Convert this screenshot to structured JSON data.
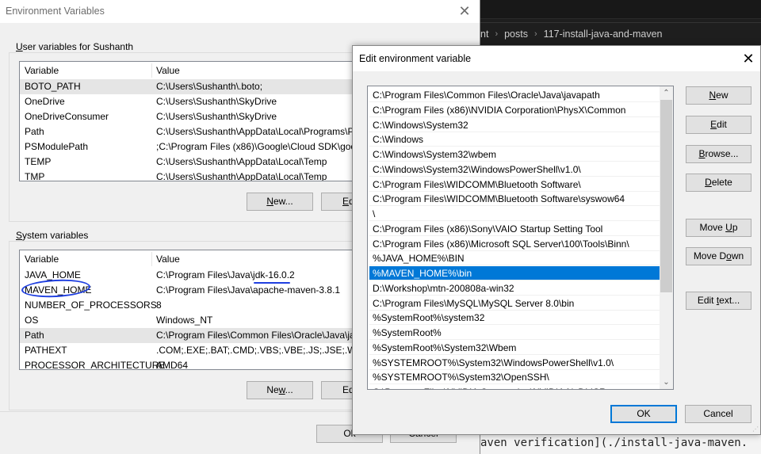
{
  "editor": {
    "breadcrumb": [
      "nt",
      "posts",
      "117-install-java-and-maven"
    ],
    "code_line": "aven verification](./install-java-maven."
  },
  "env_window": {
    "title": "Environment Variables",
    "close_icon": "close-icon",
    "user_group_label": "User variables for Sushanth",
    "user_group_hotkey": "U",
    "user_columns": [
      "Variable",
      "Value"
    ],
    "user_vars": [
      {
        "name": "BOTO_PATH",
        "value": "C:\\Users\\Sushanth\\.boto;"
      },
      {
        "name": "OneDrive",
        "value": "C:\\Users\\Sushanth\\SkyDrive"
      },
      {
        "name": "OneDriveConsumer",
        "value": "C:\\Users\\Sushanth\\SkyDrive"
      },
      {
        "name": "Path",
        "value": "C:\\Users\\Sushanth\\AppData\\Local\\Programs\\P"
      },
      {
        "name": "PSModulePath",
        "value": ";C:\\Program Files (x86)\\Google\\Cloud SDK\\goo"
      },
      {
        "name": "TEMP",
        "value": "C:\\Users\\Sushanth\\AppData\\Local\\Temp"
      },
      {
        "name": "TMP",
        "value": "C:\\Users\\Sushanth\\AppData\\Local\\Temp"
      }
    ],
    "user_buttons": {
      "new": "New...",
      "edit": "Ed"
    },
    "system_group_label": "System variables",
    "system_columns": [
      "Variable",
      "Value"
    ],
    "system_vars": [
      {
        "name": "JAVA_HOME",
        "value": "C:\\Program Files\\Java\\jdk-16.0.2"
      },
      {
        "name": "MAVEN_HOME",
        "value": "C:\\Program Files\\Java\\apache-maven-3.8.1"
      },
      {
        "name": "NUMBER_OF_PROCESSORS",
        "value": "8"
      },
      {
        "name": "OS",
        "value": "Windows_NT"
      },
      {
        "name": "Path",
        "value": "C:\\Program Files\\Common Files\\Oracle\\Java\\ja"
      },
      {
        "name": "PATHEXT",
        "value": ".COM;.EXE;.BAT;.CMD;.VBS;.VBE;.JS;.JSE;.WSF;.W"
      },
      {
        "name": "PROCESSOR_ARCHITECTURE",
        "value": "AMD64"
      }
    ],
    "system_buttons": {
      "new": "New...",
      "edit": "Ed"
    },
    "footer_buttons": {
      "ok": "Ok",
      "cancel": "Cancel"
    }
  },
  "edit_dialog": {
    "title": "Edit environment variable",
    "close_icon": "close-icon",
    "paths": [
      "C:\\Program Files\\Common Files\\Oracle\\Java\\javapath",
      "C:\\Program Files (x86)\\NVIDIA Corporation\\PhysX\\Common",
      "C:\\Windows\\System32",
      "C:\\Windows",
      "C:\\Windows\\System32\\wbem",
      "C:\\Windows\\System32\\WindowsPowerShell\\v1.0\\",
      "C:\\Program Files\\WIDCOMM\\Bluetooth Software\\",
      "C:\\Program Files\\WIDCOMM\\Bluetooth Software\\syswow64",
      "\\",
      "C:\\Program Files (x86)\\Sony\\VAIO Startup Setting Tool",
      "C:\\Program Files (x86)\\Microsoft SQL Server\\100\\Tools\\Binn\\",
      "%JAVA_HOME%\\BIN",
      "%MAVEN_HOME%\\bin",
      "D:\\Workshop\\mtn-200808a-win32",
      "C:\\Program Files\\MySQL\\MySQL Server 8.0\\bin",
      "%SystemRoot%\\system32",
      "%SystemRoot%",
      "%SystemRoot%\\System32\\Wbem",
      "%SYSTEMROOT%\\System32\\WindowsPowerShell\\v1.0\\",
      "%SYSTEMROOT%\\System32\\OpenSSH\\",
      "C:\\Program Files\\NVIDIA Corporation\\NVIDIA NvDLISR"
    ],
    "selected_index": 12,
    "scroll_position": 0.0,
    "buttons": {
      "new": "New",
      "edit": "Edit",
      "browse": "Browse...",
      "delete": "Delete",
      "move_up": "Move Up",
      "move_down": "Move Down",
      "edit_text": "Edit text...",
      "ok": "OK",
      "cancel": "Cancel"
    },
    "accent_color": "#0078d7"
  },
  "annotations": {
    "color": "#1f3fe0",
    "circled": "MAVEN_HOME",
    "underlined": "jdk-16.0.2"
  }
}
